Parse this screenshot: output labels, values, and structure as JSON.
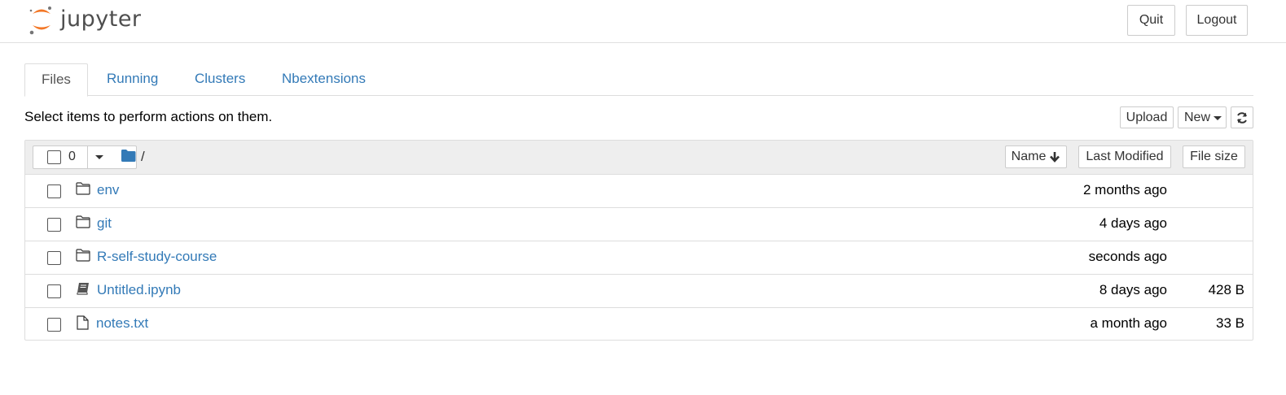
{
  "header": {
    "logo_text": "jupyter",
    "quit_label": "Quit",
    "logout_label": "Logout"
  },
  "tabs": [
    {
      "label": "Files",
      "active": true
    },
    {
      "label": "Running",
      "active": false
    },
    {
      "label": "Clusters",
      "active": false
    },
    {
      "label": "Nbextensions",
      "active": false
    }
  ],
  "toolbar": {
    "hint": "Select items to perform actions on them.",
    "upload_label": "Upload",
    "new_label": "New",
    "refresh_icon": "refresh-icon"
  },
  "list_header": {
    "selected_count": "0",
    "breadcrumb": "/",
    "sort_name_label": "Name",
    "sort_modified_label": "Last Modified",
    "sort_size_label": "File size"
  },
  "items": [
    {
      "name": "env",
      "icon": "folder-icon",
      "modified": "2 months ago",
      "size": ""
    },
    {
      "name": "git",
      "icon": "folder-icon",
      "modified": "4 days ago",
      "size": ""
    },
    {
      "name": "R-self-study-course",
      "icon": "folder-icon",
      "modified": "seconds ago",
      "size": ""
    },
    {
      "name": "Untitled.ipynb",
      "icon": "notebook-icon",
      "modified": "8 days ago",
      "size": "428 B"
    },
    {
      "name": "notes.txt",
      "icon": "file-icon",
      "modified": "a month ago",
      "size": "33 B"
    }
  ],
  "colors": {
    "link": "#337ab7",
    "logo_orange": "#f37726",
    "logo_gray": "#767677"
  }
}
